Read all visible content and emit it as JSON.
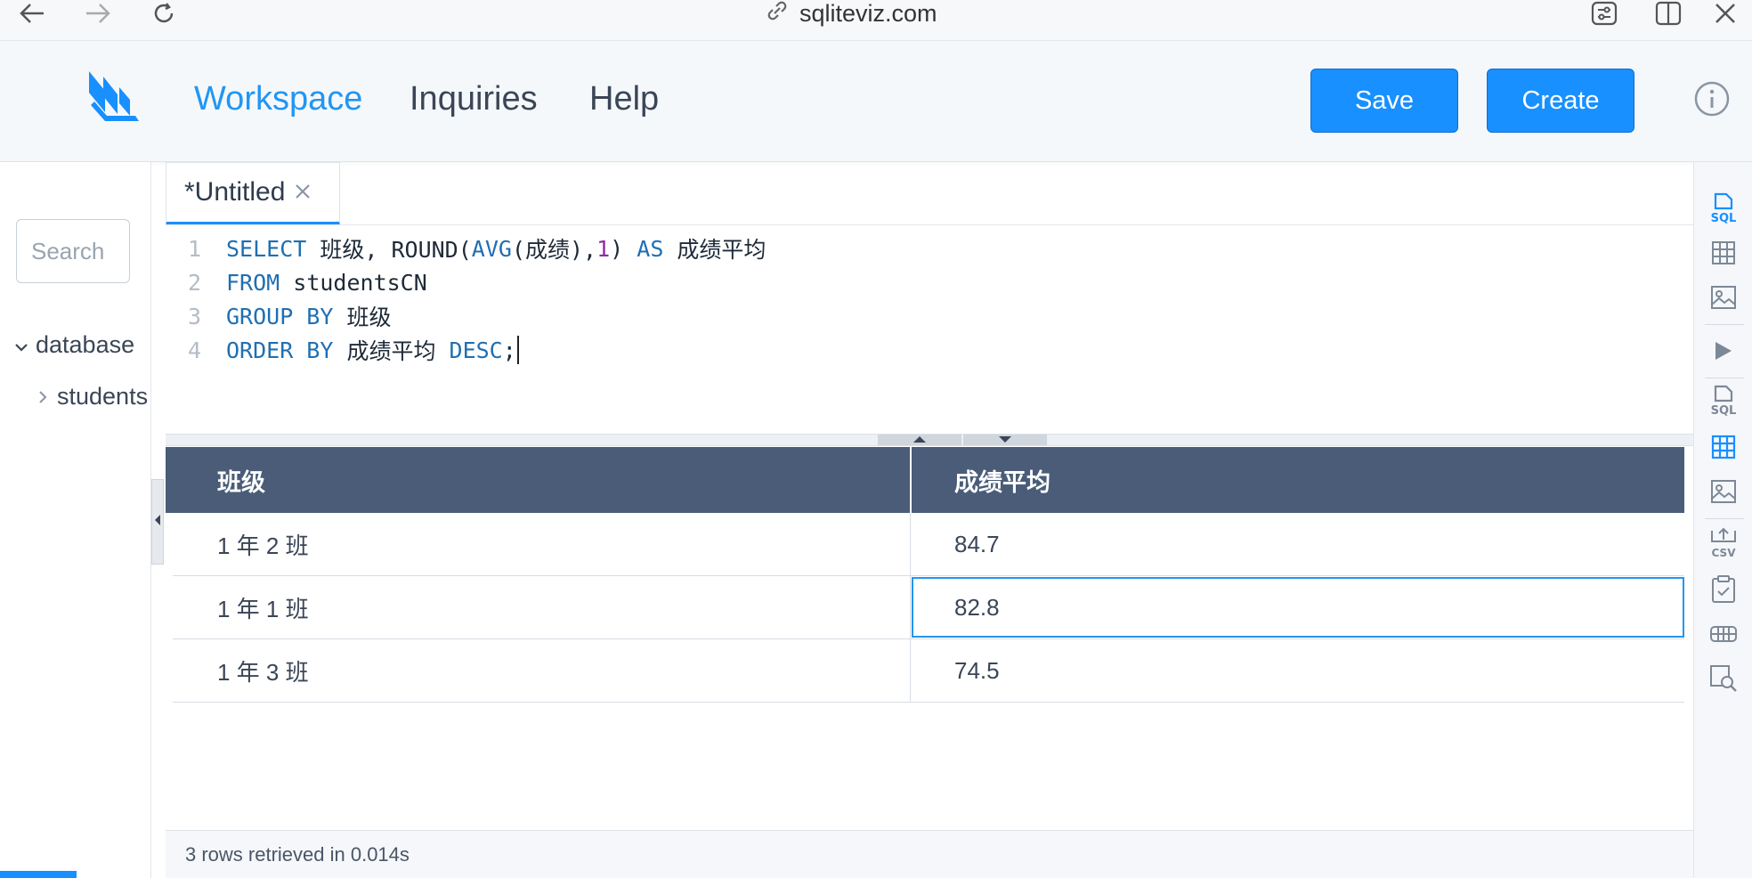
{
  "browser": {
    "url": "sqliteviz.com"
  },
  "header": {
    "nav": [
      "Workspace",
      "Inquiries",
      "Help"
    ],
    "active_nav": "Workspace",
    "save_label": "Save",
    "create_label": "Create",
    "accent_color": "#1890ff"
  },
  "sidebar": {
    "search_placeholder": "Search",
    "database_label": "database",
    "table_label": "students"
  },
  "tab": {
    "title": "*Untitled"
  },
  "editor": {
    "line_numbers": [
      "1",
      "2",
      "3",
      "4"
    ],
    "line1": {
      "kw1": "SELECT",
      "t1": " 班级, ROUND(",
      "kw2": "AVG",
      "t2": "(成绩),",
      "num": "1",
      "t3": ") ",
      "kw3": "AS",
      "t4": " 成绩平均"
    },
    "line2": {
      "kw1": "FROM",
      "t1": " studentsCN"
    },
    "line3": {
      "kw1": "GROUP BY",
      "t1": " 班级"
    },
    "line4": {
      "kw1": "ORDER BY",
      "t1": " 成绩平均 ",
      "kw2": "DESC",
      "t2": ";"
    }
  },
  "results": {
    "columns": [
      "班级",
      "成绩平均"
    ],
    "rows": [
      [
        "1 年 2 班",
        "84.7"
      ],
      [
        "1 年 1 班",
        "82.8"
      ],
      [
        "1 年 3 班",
        "74.5"
      ]
    ],
    "header_bg": "#4a5c78",
    "status": "3 rows retrieved in 0.014s"
  },
  "toolbar_icons": [
    "sql-icon",
    "table-icon",
    "image-icon",
    "run-icon",
    "sql-icon",
    "table-icon",
    "image-icon",
    "csv-export-icon",
    "clipboard-icon",
    "pivot-icon",
    "search-data-icon"
  ]
}
